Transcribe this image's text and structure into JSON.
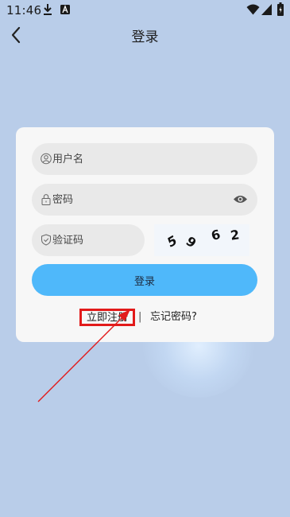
{
  "status_bar": {
    "time": "11:46",
    "icons": [
      "download-icon",
      "a-box-icon",
      "wifi-icon",
      "signal-icon",
      "battery-icon"
    ]
  },
  "nav": {
    "title": "登录",
    "back_icon": "chevron-left-icon"
  },
  "form": {
    "username_placeholder": "用户名",
    "password_placeholder": "密码",
    "captcha_placeholder": "验证码",
    "captcha_chars": [
      "5",
      "9",
      "6",
      "2"
    ],
    "login_label": "登录"
  },
  "links": {
    "register": "立即注册",
    "divider": "|",
    "forgot": "忘记密码?"
  },
  "colors": {
    "background": "#b9cde9",
    "card": "#f7f7f7",
    "field": "#e9e9e9",
    "button": "#4fb8fa",
    "highlight": "#e21a1a"
  }
}
